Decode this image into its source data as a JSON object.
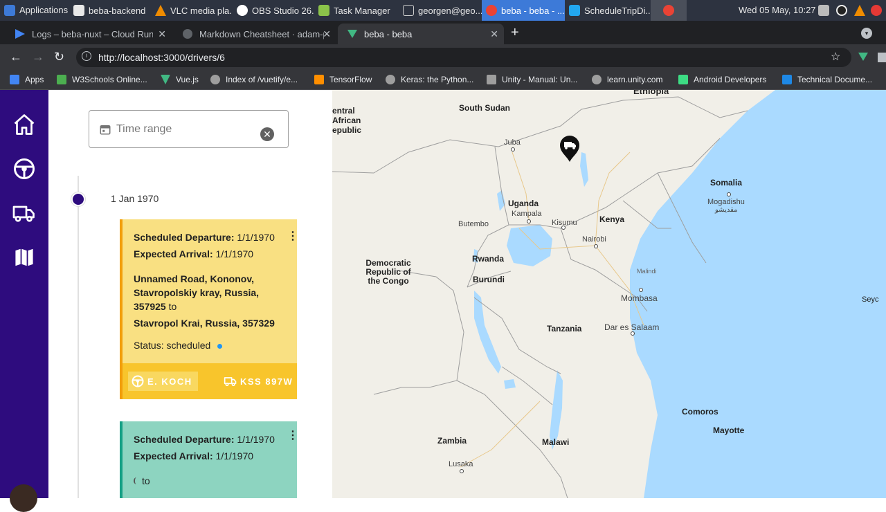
{
  "taskbar": {
    "items": [
      {
        "label": "Applications ☰",
        "color": "#3d7ad8"
      },
      {
        "label": "beba-backend",
        "color": "#e8e8e8"
      },
      {
        "label": "VLC media pla...",
        "color": "#f08c00"
      },
      {
        "label": "OBS Studio 26....",
        "color": "#ffffff"
      },
      {
        "label": "Task Manager",
        "color": "#8bc34a"
      },
      {
        "label": "georgen@geo...",
        "color": "#cccccc"
      },
      {
        "label": "beba - beba - ...",
        "color": "#ea4335"
      },
      {
        "label": "ScheduleTripDi...",
        "color": "#22a7f0"
      },
      {
        "label": "",
        "color": "#ea4335"
      }
    ],
    "clock": "Wed 05 May, 10:27"
  },
  "browser": {
    "tabs": [
      {
        "title": "Logs – beba-nuxt – Cloud Run –",
        "close": "✕"
      },
      {
        "title": "Markdown Cheatsheet · adam-p",
        "close": "✕"
      },
      {
        "title": "beba - beba",
        "close": "✕"
      }
    ],
    "new_tab": "+",
    "url": "http://localhost:3000/drivers/6",
    "bookmarks": [
      {
        "label": "Apps",
        "color": "#4285f4"
      },
      {
        "label": "W3Schools Online...",
        "color": "#4caf50"
      },
      {
        "label": "Vue.js",
        "color": "#41b883"
      },
      {
        "label": "Index of /vuetify/e...",
        "color": "#9e9e9e"
      },
      {
        "label": "TensorFlow",
        "color": "#ff8f00"
      },
      {
        "label": "Keras: the Python...",
        "color": "#9e9e9e"
      },
      {
        "label": "Unity - Manual: Un...",
        "color": "#9e9e9e"
      },
      {
        "label": "learn.unity.com",
        "color": "#9e9e9e"
      },
      {
        "label": "Android Developers",
        "color": "#3ddc84"
      },
      {
        "label": "Technical Docume...",
        "color": "#1e88e5"
      }
    ]
  },
  "sidenav": {
    "items": [
      "home-icon",
      "steering-wheel-icon",
      "truck-icon",
      "map-icon"
    ],
    "color": "#2e0c7e"
  },
  "filter": {
    "time_range_label": "Time range",
    "clear": "✕"
  },
  "timeline": {
    "date": "1 Jan 1970",
    "trips": [
      {
        "departure_label": "Scheduled Departure:",
        "departure": "1/1/1970",
        "arrival_label": "Expected Arrival:",
        "arrival": "1/1/1970",
        "origin_line1": "Unnamed Road, Kononov,",
        "origin_line2": "Stavropolskiy kray, Russia,",
        "origin_line3": "357925",
        "to": "to",
        "destination": "Stavropol Krai, Russia, 357329",
        "status_label": "Status:",
        "status": "scheduled",
        "driver": "E. KOCH",
        "vehicle": "KSS 897W",
        "menu": "⋮",
        "color": "#f9e082",
        "accent": "#f29e0b"
      },
      {
        "departure_label": "Scheduled Departure:",
        "departure": "1/1/1970",
        "arrival_label": "Expected Arrival:",
        "arrival": "1/1/1970",
        "to": "to",
        "menu": "⋮",
        "color": "#8dd4c0",
        "accent": "#16a085"
      }
    ]
  },
  "map": {
    "countries": [
      "South Sudan",
      "Uganda",
      "Kenya",
      "Somalia",
      "Democratic Republic of the Congo",
      "Rwanda",
      "Burundi",
      "Tanzania",
      "Zambia",
      "Malawi",
      "Comoros",
      "Mayotte",
      "Ethiopia",
      "Seychelles"
    ],
    "cities": [
      "Juba",
      "Kampala",
      "Kisumu",
      "Nairobi",
      "Mogadishu",
      "مقديشو",
      "Butembo",
      "Malindi",
      "Mombasa",
      "Dar es Salaam",
      "Lusaka"
    ],
    "car_label_partial": "entral African epublic",
    "seychelles_partial": "Seyc",
    "ethiopia_partial": "Ethiopia",
    "colors": {
      "water": "#aadaff",
      "land": "#f1efe8",
      "border": "#9e9e9e"
    }
  }
}
